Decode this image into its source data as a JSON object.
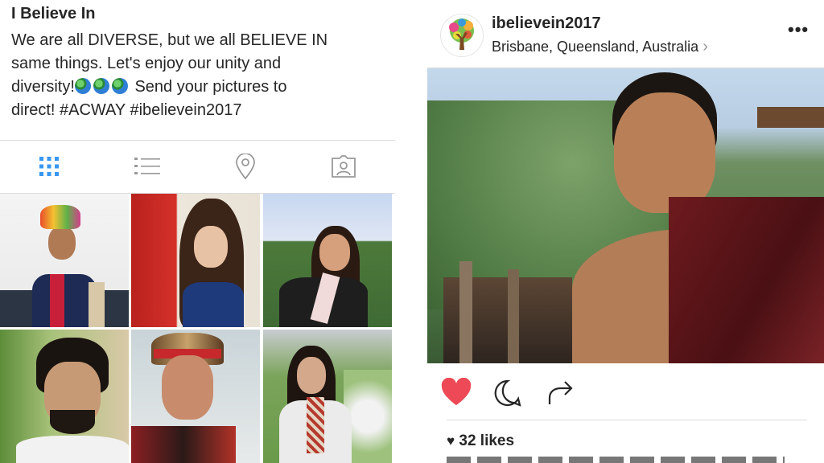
{
  "profile": {
    "name": "I Believe In",
    "bio_line1": "We are all DIVERSE, but we all BELIEVE IN",
    "bio_line2": "same things. Let's enjoy our unity and",
    "bio_line3_before": "diversity!",
    "bio_line3_after": " Send your pictures to",
    "bio_line4": "direct! #ACWAY #ibelievein2017",
    "globe_icons": [
      "globe-icon",
      "globe-icon",
      "globe-icon"
    ]
  },
  "tabs": [
    {
      "name": "grid-view",
      "icon": "grid-icon",
      "active": true,
      "color": "#3897f0"
    },
    {
      "name": "list-view",
      "icon": "list-icon",
      "active": false,
      "color": "#999999"
    },
    {
      "name": "places",
      "icon": "location-pin-icon",
      "active": false,
      "color": "#999999"
    },
    {
      "name": "tagged",
      "icon": "tagged-person-icon",
      "active": false,
      "color": "#999999"
    }
  ],
  "grid_photos": [
    {
      "subject": "man in turban and red scarf"
    },
    {
      "subject": "woman smiling in red chair"
    },
    {
      "subject": "woman outdoors with white scarf"
    },
    {
      "subject": "man with beard and glasses"
    },
    {
      "subject": "young man with headband"
    },
    {
      "subject": "woman in scarf with flowers"
    }
  ],
  "post": {
    "username": "ibelievein2017",
    "location": "Brisbane, Queensland, Australia",
    "location_chevron": "›",
    "more_label": "•••",
    "liked": true,
    "likes_text": "32 likes",
    "heart_color": "#ed4956"
  }
}
